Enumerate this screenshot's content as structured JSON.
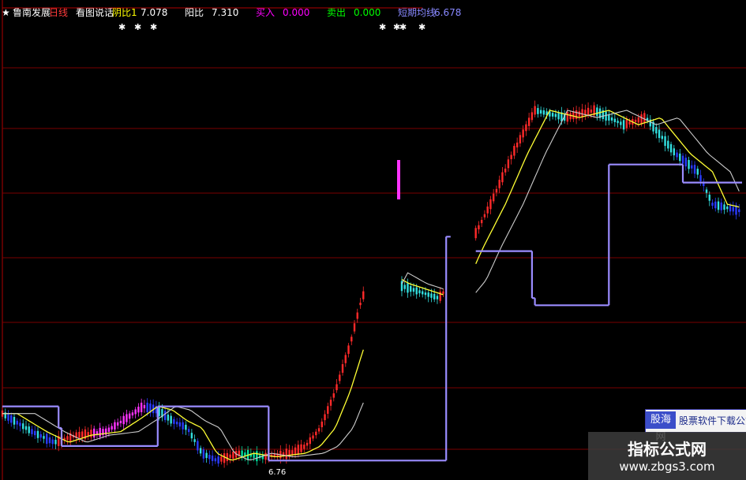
{
  "header": {
    "star": "★",
    "items": [
      {
        "text": "鲁南发展",
        "color": "#ffffff"
      },
      {
        "text": "日线",
        "color": "#ff3b3b"
      },
      {
        "text": "看图说话",
        "color": "#ffffff"
      },
      {
        "text": "阴比1",
        "color": "#ffff00"
      },
      {
        "text": "7.078",
        "color": "#ffffff"
      },
      {
        "text": "阳比",
        "color": "#ffffff"
      },
      {
        "text": "7.310",
        "color": "#ffffff"
      },
      {
        "text": "买入",
        "color": "#ff00ff"
      },
      {
        "text": "0.000",
        "color": "#ff00ff"
      },
      {
        "text": "卖出",
        "color": "#00ff00"
      },
      {
        "text": "0.000",
        "color": "#00ff00"
      },
      {
        "text": "短期均线",
        "color": "#8888ff"
      },
      {
        "text": "6.678",
        "color": "#8888ff"
      }
    ]
  },
  "price_label": "6.76",
  "logo": {
    "left": "股海网",
    "right": "股票软件下载公式"
  },
  "watermark": {
    "title": "指标公式网",
    "url": "www.zbgs3.com"
  },
  "colors": {
    "background": "#000000",
    "grid": "#7a0000",
    "step_line": "#9a8cff",
    "ma_fast": "#ffff33",
    "ma_slow": "#cccccc",
    "candle_up": "#ff2a2a",
    "candle_down": "#33e0e0",
    "candle_deep": "#2a3cff",
    "candle_pink": "#ff33ff",
    "frame": "#b00000"
  },
  "chart_data": {
    "type": "line",
    "description_series": [
      {
        "name": "阴比1",
        "value": 7.078
      },
      {
        "name": "阳比",
        "value": 7.31
      },
      {
        "name": "买入",
        "value": 0.0
      },
      {
        "name": "卖出",
        "value": 0.0
      },
      {
        "name": "短期均线",
        "value": 6.678
      }
    ],
    "low_marker": 6.76,
    "bars": 250,
    "step_segments": [
      [
        0,
        38,
        0.18
      ],
      [
        38,
        40,
        0.12
      ],
      [
        40,
        105,
        0.07
      ],
      [
        105,
        108,
        0.18
      ],
      [
        108,
        180,
        0.18
      ],
      [
        180,
        300,
        0.03
      ],
      [
        300,
        303,
        0.65
      ],
      [
        320,
        358,
        0.61
      ],
      [
        358,
        360,
        0.48
      ],
      [
        360,
        410,
        0.46
      ],
      [
        410,
        413,
        0.85
      ],
      [
        413,
        460,
        0.85
      ],
      [
        460,
        480,
        0.8
      ],
      [
        480,
        500,
        0.8
      ]
    ]
  }
}
